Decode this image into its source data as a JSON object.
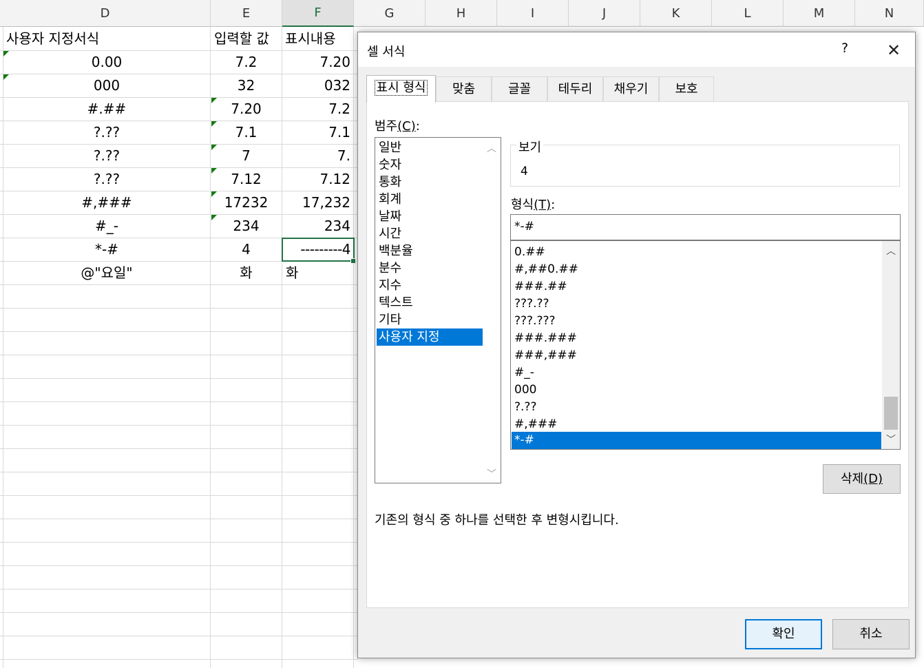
{
  "sheet": {
    "columns": [
      "D",
      "E",
      "F",
      "G",
      "H",
      "I",
      "J",
      "K",
      "L",
      "M",
      "N"
    ],
    "rows": [
      {
        "d": "사용자 지정서식",
        "e": "입력할 값",
        "f": "표시내용"
      },
      {
        "d": "0.00",
        "e": "7.2",
        "f": "7.20"
      },
      {
        "d": "000",
        "e": "32",
        "f": "032"
      },
      {
        "d": "#.##",
        "e": "7.20",
        "f": "7.2"
      },
      {
        "d": "?.??",
        "e": "7.1",
        "f": "7.1"
      },
      {
        "d": "?.??",
        "e": "7",
        "f": "7."
      },
      {
        "d": "?.??",
        "e": "7.12",
        "f": "7.12"
      },
      {
        "d": "#,###",
        "e": "17232",
        "f": "17,232"
      },
      {
        "d": "#_-",
        "e": "234",
        "f": "234"
      },
      {
        "d": "*-#",
        "e": "4",
        "f": "---------4"
      },
      {
        "d": "@\"요일\"",
        "e": "화",
        "f": "화"
      }
    ]
  },
  "dialog": {
    "title": "셀 서식",
    "help": "?",
    "close": "✕",
    "tabs": [
      "표시 형식",
      "맞춤",
      "글꼴",
      "테두리",
      "채우기",
      "보호"
    ],
    "category_label": "범주",
    "category_hotkey": "(C)",
    "category_colon": ":",
    "categories": [
      "일반",
      "숫자",
      "통화",
      "회계",
      "날짜",
      "시간",
      "백분율",
      "분수",
      "지수",
      "텍스트",
      "기타",
      "사용자 지정"
    ],
    "preview_label": "보기",
    "preview_value": "4",
    "format_label": "형식",
    "format_hotkey": "(T)",
    "format_colon": ":",
    "format_value": "*-#",
    "formats": [
      "0.##",
      "#,##0.##",
      "###.##",
      "???.??",
      "???.???",
      "###.###",
      "###,###",
      "#_-",
      "000",
      "?.??",
      "#,###",
      "*-#"
    ],
    "delete_label": "삭제",
    "delete_hotkey": "(D)",
    "description": "기존의 형식 중 하나를 선택한 후 변형시킵니다.",
    "ok_label": "확인",
    "cancel_label": "취소"
  }
}
